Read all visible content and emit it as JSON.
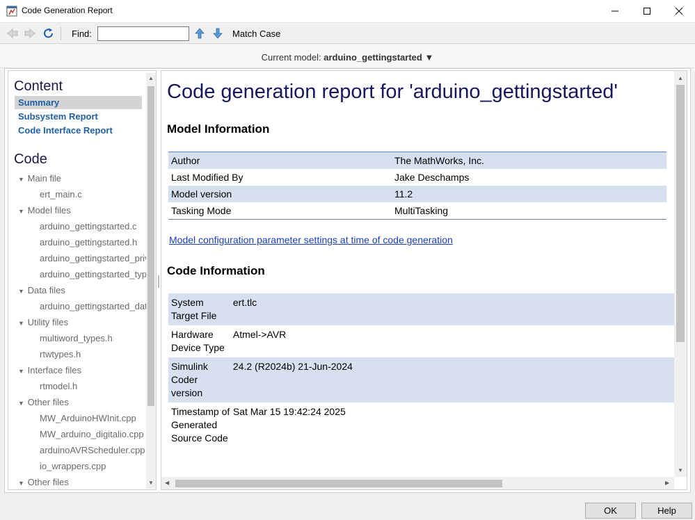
{
  "window": {
    "title": "Code Generation Report"
  },
  "toolbar": {
    "find_label": "Find:",
    "find_value": "",
    "match_case_label": "Match Case"
  },
  "model_bar": {
    "prefix": "Current model:",
    "model_name": "arduino_gettingstarted",
    "dropdown_glyph": "▼"
  },
  "left_nav": {
    "content_heading": "Content",
    "content_links": [
      "Summary",
      "Subsystem Report",
      "Code Interface Report"
    ],
    "code_heading": "Code",
    "groups": [
      {
        "label": "Main file",
        "files": [
          "ert_main.c"
        ]
      },
      {
        "label": "Model files",
        "files": [
          "arduino_gettingstarted.c",
          "arduino_gettingstarted.h",
          "arduino_gettingstarted_private.h",
          "arduino_gettingstarted_types.h"
        ]
      },
      {
        "label": "Data files",
        "files": [
          "arduino_gettingstarted_data.c"
        ]
      },
      {
        "label": "Utility files",
        "files": [
          "multiword_types.h",
          "rtwtypes.h"
        ]
      },
      {
        "label": "Interface files",
        "files": [
          "rtmodel.h"
        ]
      },
      {
        "label": "Other files",
        "files": [
          "MW_ArduinoHWInit.cpp",
          "MW_arduino_digitalio.cpp",
          "arduinoAVRScheduler.cpp",
          "io_wrappers.cpp"
        ]
      },
      {
        "label": "Other files",
        "files": []
      }
    ]
  },
  "report": {
    "title": "Code generation report for 'arduino_gettingstarted'",
    "model_info_heading": "Model Information",
    "model_info": [
      {
        "key": "Author",
        "value": "The MathWorks, Inc."
      },
      {
        "key": "Last Modified By",
        "value": "Jake Deschamps"
      },
      {
        "key": "Model version",
        "value": "11.2"
      },
      {
        "key": "Tasking Mode",
        "value": "MultiTasking"
      }
    ],
    "config_link": "Model configuration parameter settings at time of code generation",
    "code_info_heading": "Code Information",
    "code_info": [
      {
        "key": "System Target File",
        "value": "ert.tlc"
      },
      {
        "key": "Hardware Device Type",
        "value": "Atmel->AVR"
      },
      {
        "key": "Simulink Coder version",
        "value": "24.2 (R2024b) 21-Jun-2024"
      },
      {
        "key": "Timestamp of Generated Source Code",
        "value": "Sat Mar 15 19:42:24 2025"
      }
    ]
  },
  "buttons": {
    "ok": "OK",
    "help": "Help"
  }
}
